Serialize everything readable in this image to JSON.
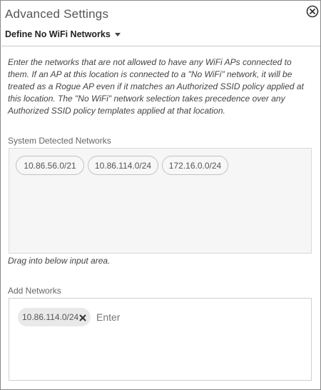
{
  "panel": {
    "title": "Advanced Settings",
    "close_icon": "close-circle-icon"
  },
  "mode_dropdown": {
    "selected": "Define No WiFi Networks"
  },
  "description": "Enter the networks that are not allowed to have any WiFi APs connected to them. If an AP at this location is connected to a \"No WiFi\" network, it will be treated as a Rogue AP even if it matches an Authorized SSID policy applied at this location. The \"No WiFi\" network selection takes precedence over any Authorized SSID policy templates applied at that location.",
  "detected": {
    "label": "System Detected Networks",
    "networks": [
      "10.86.56.0/21",
      "10.86.114.0/24",
      "172.16.0.0/24"
    ]
  },
  "drag_hint": "Drag into below input area.",
  "add_networks": {
    "label": "Add Networks",
    "added": [
      "10.86.114.0/24"
    ],
    "input_value": "",
    "input_placeholder": "Enter",
    "remove_icon": "close-x-icon"
  },
  "colors": {
    "border": "#8a8a8a",
    "chip_background": "#f7f7f7",
    "added_chip_background": "#e9e9e9"
  }
}
